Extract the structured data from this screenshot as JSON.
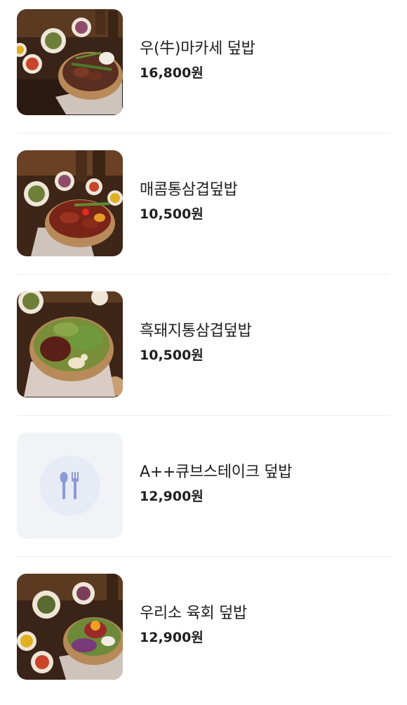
{
  "menu": {
    "items": [
      {
        "name": "우(牛)마카세 덮밥",
        "price": "16,800원",
        "image": "food-photo-beef-bowl"
      },
      {
        "name": "매콤통삼겹덮밥",
        "price": "10,500원",
        "image": "food-photo-spicy-pork-bowl"
      },
      {
        "name": "흑돼지통삼겹덮밥",
        "price": "10,500원",
        "image": "food-photo-black-pork-bowl"
      },
      {
        "name": "A++큐브스테이크 덮밥",
        "price": "12,900원",
        "image": "utensils-icon"
      },
      {
        "name": "우리소 육회 덮밥",
        "price": "12,900원",
        "image": "food-photo-yukhoe-bowl"
      }
    ]
  },
  "colors": {
    "text": "#1f1f1f",
    "divider": "#eeeeee",
    "placeholder_bg": "#f2f3f6",
    "placeholder_circle": "#e6ebf5",
    "placeholder_icon": "#8c9ad6"
  }
}
